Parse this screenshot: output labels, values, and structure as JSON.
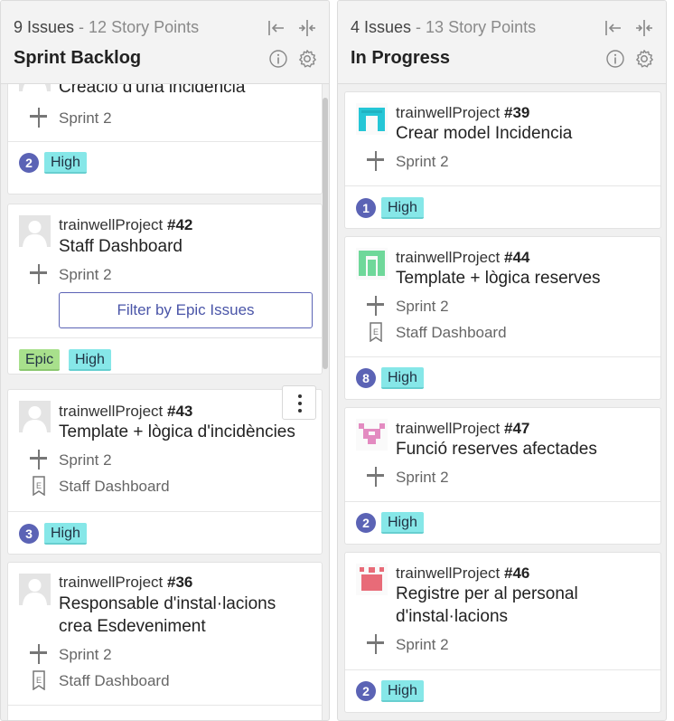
{
  "colors": {
    "points_badge": "#5b63b5",
    "high_tag": "#86e7e8",
    "epic_tag": "#a8e08c",
    "filter_button": "#5b63b5"
  },
  "icons": {
    "collapse": "collapse-left-icon",
    "compact": "compact-icon",
    "info": "info-icon",
    "settings": "gear-icon",
    "sprint": "signpost-icon",
    "epic": "epic-bookmark-icon",
    "more": "kebab-menu-icon"
  },
  "backlog": {
    "issues": "9 Issues",
    "points": " - 12 Story Points",
    "title": "Sprint Backlog",
    "cards": [
      {
        "summary": "Creació d'una incidència",
        "sprint": "Sprint 2",
        "points": "2",
        "priority": "High"
      },
      {
        "project": "trainwellProject ",
        "number": "#42",
        "summary": "Staff Dashboard",
        "sprint": "Sprint 2",
        "filter_label": "Filter by Epic Issues",
        "epic_tag": "Epic",
        "priority": "High"
      },
      {
        "project": "trainwellProject ",
        "number": "#43",
        "summary": "Template + lògica d'incidències",
        "sprint": "Sprint 2",
        "epic": "Staff Dashboard",
        "points": "3",
        "priority": "High"
      },
      {
        "project": "trainwellProject ",
        "number": "#36",
        "summary_line1": "Responsable d'instal·lacions",
        "summary_line2": "crea Esdeveniment",
        "sprint": "Sprint 2",
        "epic": "Staff Dashboard"
      }
    ]
  },
  "progress": {
    "issues": "4 Issues",
    "points": " - 13 Story Points",
    "title": "In Progress",
    "cards": [
      {
        "project": "trainwellProject ",
        "number": "#39",
        "summary": "Crear model Incidencia",
        "sprint": "Sprint 2",
        "points": "1",
        "priority": "High"
      },
      {
        "project": "trainwellProject ",
        "number": "#44",
        "summary": "Template + lògica reserves",
        "sprint": "Sprint 2",
        "epic": "Staff Dashboard",
        "points": "8",
        "priority": "High"
      },
      {
        "project": "trainwellProject ",
        "number": "#47",
        "summary": "Funció reserves afectades",
        "sprint": "Sprint 2",
        "points": "2",
        "priority": "High"
      },
      {
        "project": "trainwellProject ",
        "number": "#46",
        "summary_line1": "Registre per al personal",
        "summary_line2": "d'instal·lacions",
        "sprint": "Sprint 2",
        "points": "2",
        "priority": "High"
      }
    ]
  }
}
